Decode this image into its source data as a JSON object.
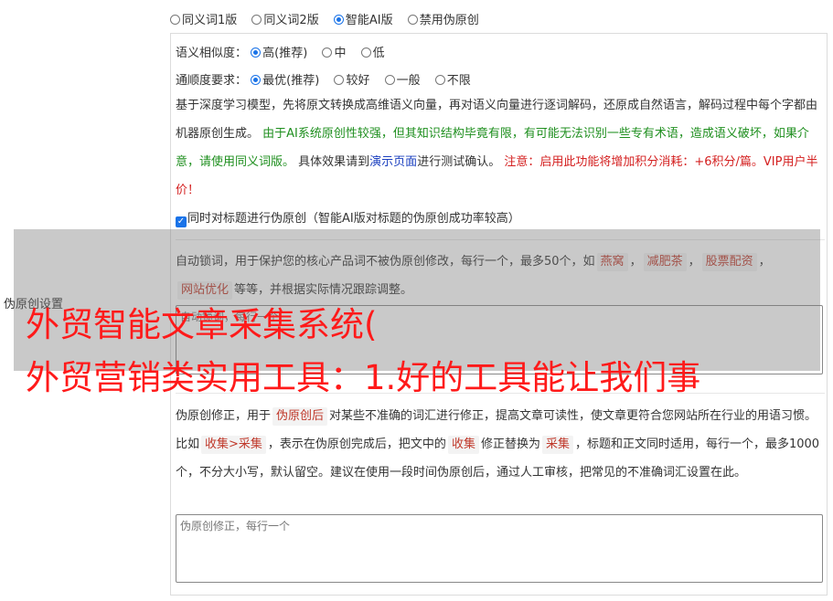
{
  "version_options": [
    {
      "label": "同义词1版",
      "selected": false
    },
    {
      "label": "同义词2版",
      "selected": false
    },
    {
      "label": "智能AI版",
      "selected": true
    },
    {
      "label": "禁用伪原创",
      "selected": false
    }
  ],
  "similarity": {
    "label": "语义相似度：",
    "options": [
      {
        "label": "高(推荐)",
        "selected": true
      },
      {
        "label": "中",
        "selected": false
      },
      {
        "label": "低",
        "selected": false
      }
    ]
  },
  "fluency": {
    "label": "通顺度要求：",
    "options": [
      {
        "label": "最优(推荐)",
        "selected": true
      },
      {
        "label": "较好",
        "selected": false
      },
      {
        "label": "一般",
        "selected": false
      },
      {
        "label": "不限",
        "selected": false
      }
    ]
  },
  "description": {
    "part1": "基于深度学习模型，先将原文转换成高维语义向量，再对语义向量进行逐词解码，还原成自然语言，解码过程中每个字都由机器原创生成。",
    "part2_green": "由于AI系统原创性较强，但其知识结构毕竟有限，有可能无法识别一些专有术语，造成语义破坏，如果介意，请使用同义词版。",
    "part3": "具体效果请到",
    "part3_link": "演示页面",
    "part3_end": "进行测试确认。",
    "part4_red": "注意：启用此功能将增加积分消耗：+6积分/篇。VIP用户半价！"
  },
  "title_checkbox": {
    "label": "同时对标题进行伪原创（智能AI版对标题的伪原创成功率较高）",
    "checked": true
  },
  "lock_words": {
    "text_before": "自动锁词，用于保护您的核心产品词不被伪原创修改，每行一个，最多50个，如",
    "examples": [
      "燕窝",
      "减肥茶",
      "股票配资",
      "网站优化"
    ],
    "separator": "，",
    "text_after": "等等，并根据实际情况跟踪调整。",
    "placeholder": "自动锁词，每行一个"
  },
  "side_label": "伪原创设置",
  "correction": {
    "text1": "伪原创修正，用于",
    "tag1": "伪原创后",
    "text2": "对某些不准确的词汇进行修正，提高文章可读性，使文章更符合您网站所在行业的用语习惯。比如",
    "tag2": "收集>采集",
    "text3": "，表示在伪原创完成后，把文中的",
    "tag3": "收集",
    "text4": "修正替换为",
    "tag4": "采集",
    "text5": "，标题和正文同时适用，每行一个，最多1000个，不分大小写，默认留空。建议在使用一段时间伪原创后，通过人工审核，把常见的不准确词汇设置在此。",
    "placeholder": "伪原创修正，每行一个"
  },
  "overlay": {
    "line1": "外贸智能文章采集系统(",
    "line2": "外贸营销类实用工具：1.好的工具能让我们事"
  }
}
